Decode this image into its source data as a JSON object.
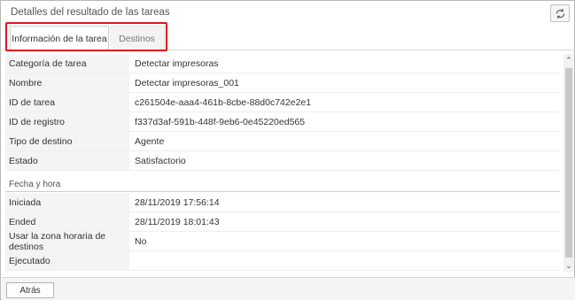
{
  "window": {
    "title": "Detalles del resultado de las tareas",
    "refresh_icon": "refresh-icon"
  },
  "tabs": [
    {
      "label": "Información de la tarea",
      "active": true
    },
    {
      "label": "Destinos",
      "active": false
    }
  ],
  "highlight_color": "#e3131f",
  "task_info": [
    {
      "label": "Categoría de tarea",
      "value": "Detectar impresoras"
    },
    {
      "label": "Nombre",
      "value": "Detectar impresoras_001"
    },
    {
      "label": "ID de tarea",
      "value": "c261504e-aaa4-461b-8cbe-88d0c742e2e1"
    },
    {
      "label": "ID de registro",
      "value": "f337d3af-591b-448f-9eb6-0e45220ed565"
    },
    {
      "label": "Tipo de destino",
      "value": "Agente"
    },
    {
      "label": "Estado",
      "value": "Satisfactorio"
    }
  ],
  "date_time": {
    "heading": "Fecha y hora",
    "rows": [
      {
        "label": "Iniciada",
        "value": "28/11/2019 17:56:14"
      },
      {
        "label": "Ended",
        "value": "28/11/2019 18:01:43"
      },
      {
        "label": "Usar la zona horaria de destinos",
        "value": "No"
      },
      {
        "label": "Ejecutado",
        "value": ""
      }
    ]
  },
  "footer": {
    "back_label": "Atrás"
  }
}
